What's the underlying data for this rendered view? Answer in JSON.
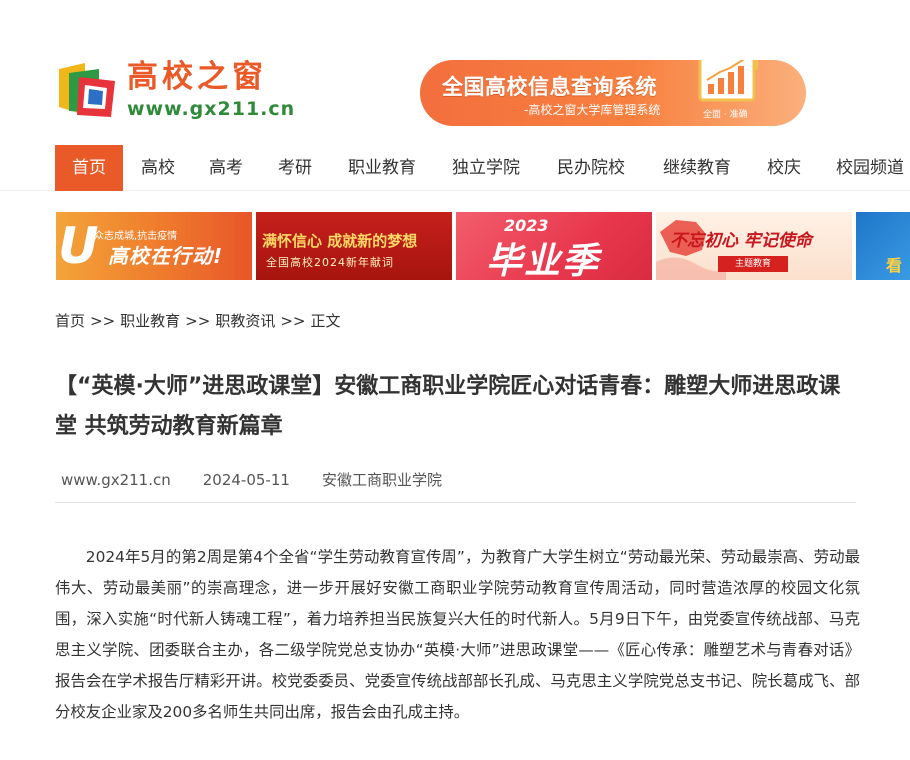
{
  "site": {
    "logo_title": "高校之窗",
    "logo_url": "www.gx211.cn"
  },
  "search_banner": {
    "title": "全国高校信息查询系统",
    "subtitle": "-高校之窗大学库管理系统",
    "slogan": "全面 · 准确"
  },
  "nav": {
    "items": [
      {
        "label": "首页",
        "active": true
      },
      {
        "label": "高校"
      },
      {
        "label": "高考"
      },
      {
        "label": "考研"
      },
      {
        "label": "职业教育"
      },
      {
        "label": "独立学院"
      },
      {
        "label": "民办院校"
      },
      {
        "label": "继续教育"
      },
      {
        "label": "校庆"
      },
      {
        "label": "校园频道"
      }
    ]
  },
  "ads": {
    "ad1": {
      "line1": "众志成城,抗击疫情",
      "line2": "高校在行动!"
    },
    "ad2": {
      "line1": "满怀信心 成就新的梦想",
      "line2": "全国高校2024新年献词"
    },
    "ad3": {
      "year": "2023",
      "text": "毕业季"
    },
    "ad4": {
      "line1": "不忘初心 牢记使命",
      "badge": "主题教育"
    },
    "ad5": {
      "text": "看"
    }
  },
  "breadcrumb": {
    "items": [
      "首页",
      "职业教育",
      "职教资讯",
      "正文"
    ],
    "separator": ">>"
  },
  "article": {
    "title": "【“英模·大师”进思政课堂】安徽工商职业学院匠心对话青春：雕塑大师进思政课堂 共筑劳动教育新篇章",
    "source": "www.gx211.cn",
    "date": "2024-05-11",
    "author_org": "安徽工商职业学院",
    "paragraph": "2024年5月的第2周是第4个全省“学生劳动教育宣传周”，为教育广大学生树立“劳动最光荣、劳动最崇高、劳动最伟大、劳动最美丽”的崇高理念，进一步开展好安徽工商职业学院劳动教育宣传周活动，同时营造浓厚的校园文化氛围，深入实施“时代新人铸魂工程”，着力培养担当民族复兴大任的时代新人。5月9日下午，由党委宣传统战部、马克思主义学院、团委联合主办，各二级学院党总支协办“英模·大师”进思政课堂——《匠心传承：雕塑艺术与青春对话》报告会在学术报告厅精彩开讲。校党委委员、党委宣传统战部部长孔成、马克思主义学院党总支书记、院长葛成飞、部分校友企业家及200多名师生共同出席，报告会由孔成主持。"
  },
  "colors": {
    "brand_orange": "#e95a28",
    "brand_green": "#2f8a3a",
    "text": "#333333"
  }
}
